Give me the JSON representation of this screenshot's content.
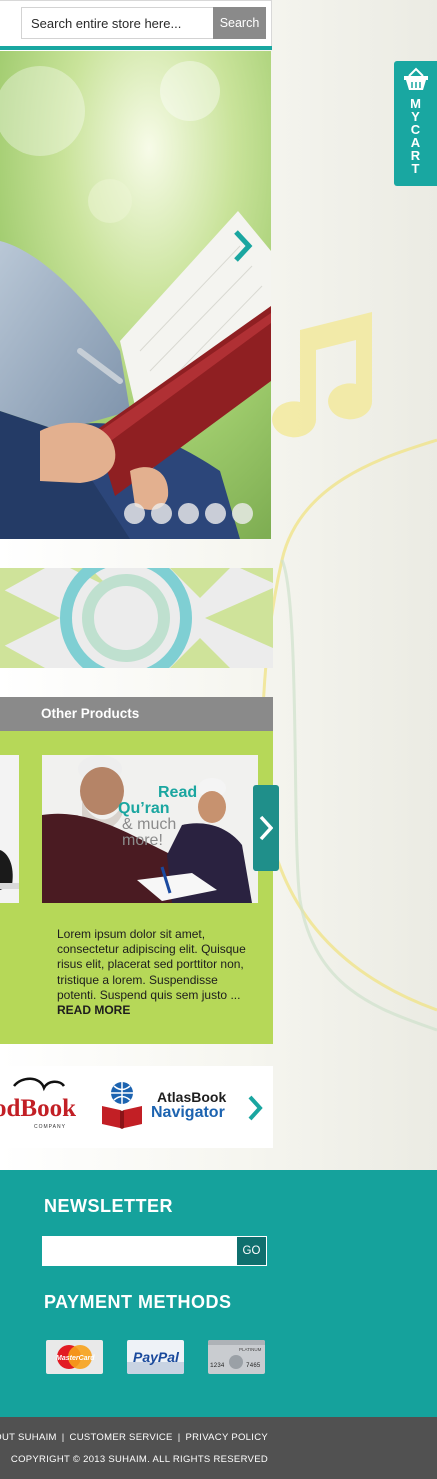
{
  "search": {
    "placeholder": "Search entire store here...",
    "button_label": "Search"
  },
  "cart": {
    "icon": "basket-icon",
    "letters": [
      "M",
      "Y",
      "C",
      "A",
      "R",
      "T"
    ]
  },
  "slider": {
    "slide_count": 5,
    "active_index": 0
  },
  "products": {
    "heading": "Other Products",
    "image_text": [
      "Read",
      "Qu’ran",
      "& much",
      "more!"
    ],
    "description": "Lorem ipsum dolor sit amet, consectetur adipiscing elit. Quisque risus elit, placerat sed porttitor non, tristique a lorem. Suspendisse potenti. Suspend quis sem justo ...",
    "read_more": "READ MORE"
  },
  "brands": {
    "brand_a_text": "odBook",
    "brand_a_sub": "COMPANY",
    "brand_b_line1": "AtlasBook",
    "brand_b_line2": "Navigator"
  },
  "newsletter": {
    "title": "NEWSLETTER",
    "button_label": "GO"
  },
  "payment": {
    "title": "PAYMENT METHODS",
    "cards": [
      {
        "label": "MasterCard"
      },
      {
        "label": "PayPal"
      },
      {
        "label": "PLATINUM",
        "number_a": "1234",
        "number_b": "7465"
      }
    ]
  },
  "footer": {
    "links": [
      "BOUT SUHAIM",
      "CUSTOMER SERVICE",
      "PRIVACY POLICY"
    ],
    "copyright": "COPYRIGHT © 2013 SUHAIM. ALL RIGHTS RESERVED"
  },
  "colors": {
    "teal": "#19a7a1",
    "lime": "#b6d858",
    "grey_header": "#8a8a8a",
    "footer_dark": "#515151"
  }
}
